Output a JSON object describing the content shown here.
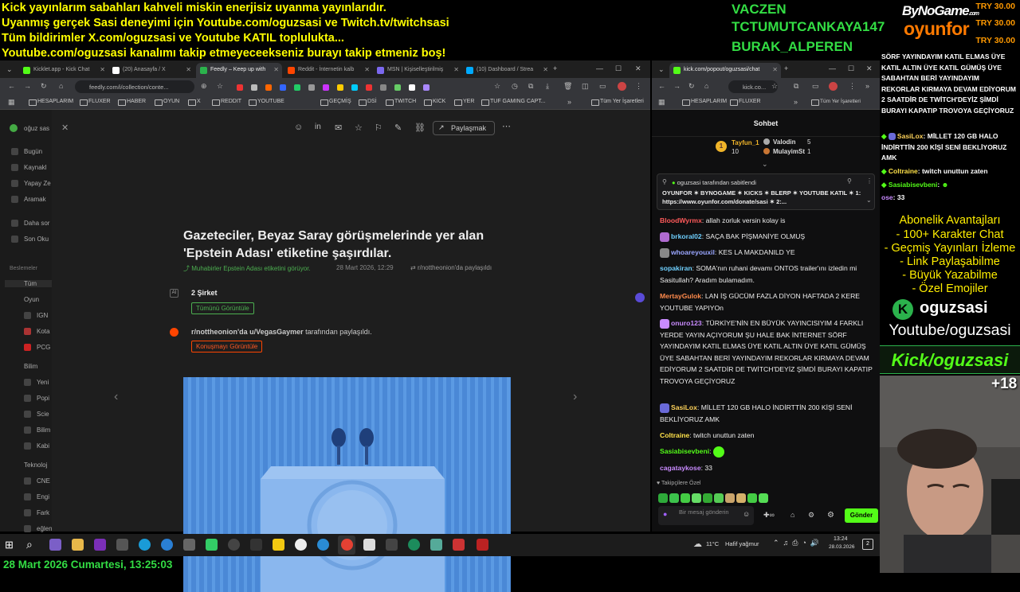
{
  "overlay": {
    "lines": [
      "Kick yayınlarım sabahları kahveli miskin enerjisiz uyanma yayınlarıdır.",
      "Uyanmış gerçek Sasi deneyimi için Youtube.com/oguzsasi ve Twitch.tv/twitchsasi",
      "Tüm bildirimler X.com/oguzsasi ve Youtube KATIL toplulukta...",
      "Youtube.com/oguzsasi kanalımı takip etmeyeceekseniz burayı takip etmeniz boş!"
    ],
    "vips": [
      "VACZEN",
      "TCTUMUTCANKAYA147",
      "BURAK_ALPEREN"
    ],
    "sponsor_top": "ByNoGame",
    "sponsor_top_small": ".com",
    "sponsor_main": "oyunfor",
    "donations": [
      "TRY 30.00",
      "TRY 30.00",
      "TRY 30.00"
    ],
    "datetime": "28 Mart 2026 Cumartesi, 13:25:03",
    "accent_yellow": "#ffff00",
    "accent_green": "#33dd44"
  },
  "left_browser": {
    "tabs": [
      {
        "label": "Kicklet.app - Kick Chat",
        "color": "#53fc18"
      },
      {
        "label": "(20) Anasayfa / X",
        "color": "#ffffff"
      },
      {
        "label": "Feedly – Keep up with",
        "color": "#2bb24c"
      },
      {
        "label": "Reddit - İnternetin kalb",
        "color": "#ff4500"
      },
      {
        "label": "MSN | Kişiselleştirilmiş",
        "color": "#7b68ee"
      },
      {
        "label": "(10) Dashboard / Strea",
        "color": "#00aaff"
      }
    ],
    "url": "feedly.com/i/collection/conte...",
    "bookmarks": [
      "HESAPLARIM",
      "FLUXER",
      "HABER",
      "OYUN",
      "X",
      "REDDIT",
      "YOUTUBE",
      "GEÇMİŞ",
      "DSİ",
      "TWITCH",
      "KICK",
      "YER",
      "TUF GAMING CAPT...",
      "Tüm Yer İşaretleri"
    ]
  },
  "feedly": {
    "user": "oğuz sas",
    "sidebar_top": [
      "Bugün",
      "Kaynakl",
      "Yapay Ze",
      "Aramak",
      "Daha sor",
      "Son Oku"
    ],
    "section_label": "Beslemeler",
    "all": "Tüm",
    "groups": [
      {
        "name": "Oyun",
        "items": [
          "IGN",
          "Kota",
          "PCG"
        ]
      },
      {
        "name": "Bilim",
        "items": [
          "Yeni",
          "Popi",
          "Scie",
          "Bilim",
          "Kabi"
        ]
      },
      {
        "name": "Teknoloj",
        "items": [
          "CNE",
          "Engi",
          "Fark",
          "eğlen"
        ]
      }
    ],
    "share_label": "Paylaşmak",
    "article_title": "Gazeteciler, Beyaz Saray görüşmelerinde yer alan 'Epstein Adası' etiketine şaşırdılar.",
    "article_source": "Muhabirler Epstein Adası etiketini görüyor.",
    "article_date": "28 Mart 2026, 12:29",
    "article_shared": "r/nottheonion'da paylaşıldı",
    "companies": "2 Şirket",
    "view_all": "Tümünü Görüntüle",
    "reddit_line_bold": "r/nottheonion'da u/VegasGaymer",
    "reddit_line_rest": " tarafından paylaşıldı.",
    "view_conv": "Konuşmayı Görüntüle"
  },
  "chat_browser": {
    "tab_label": "kick.com/popout/oguzsasi/chat",
    "url": "kick.co...",
    "bookmarks": [
      "HESAPLARIM",
      "FLUXER",
      "Tüm Yer İşaretleri"
    ],
    "header": "Sohbet",
    "leaders": [
      {
        "name": "Tayfun_1",
        "count": "10"
      },
      {
        "name": "Valodin",
        "count": "5"
      },
      {
        "name": "MulayimSt",
        "count": "1"
      }
    ],
    "pinned_by": "oguzsasi tarafından sabitlendi",
    "pinned_text": "OYUNFOR ✶ BYNOGAME ✶ KICKS ✶ BLERP ✶ YOUTUBE KATIL ✶ 1: https://www.oyunfor.com/donate/sasi ✶ 2:...",
    "messages": [
      {
        "user": "BloodWyrmx",
        "color": "#ff5a5a",
        "text": "allah zorluk versin kolay is"
      },
      {
        "user": "brkoral02",
        "color": "#6fd0ff",
        "text": "SAÇA BAK PİŞMANİYE OLMUŞ"
      },
      {
        "user": "whoareyouxil",
        "color": "#9aa6ff",
        "text": "KES LA MAKDANILD YE"
      },
      {
        "user": "sopakiran",
        "color": "#6fd0ff",
        "text": "SOMA'nın ruhani devamı ONTOS trailer'ını izledin mi Sasitullah? Aradım bulamadım."
      },
      {
        "user": "MertayGulok",
        "color": "#ff8a4c",
        "text": "LAN İŞ GÜCÜM FAZLA DİYON HAFTADA 2 KERE YOUTUBE YAPIYOn"
      },
      {
        "user": "onuro123",
        "color": "#c98bff",
        "text": "TÜRKİYE'NİN EN BÜYÜK YAYINCISIYIM 4 FARKLI YERDE YAYIN AÇIYORUM ŞU HALE BAK İNTERNET SÖRF YAYINDAYIM KATIL ELMAS ÜYE KATIL ALTIN ÜYE KATIL GÜMÜŞ ÜYE SABAHTAN BERİ YAYINDAYIM REKORLAR KIRMAYA DEVAM EDİYORUM 2 SAATDİR DE TWİTCH'DEYİZ ŞİMDİ BURAYI KAPATIP TROVOYA GEÇİYORUZ"
      },
      {
        "user": "SasiLox",
        "color": "#ffd35a",
        "text": "MİLLET 120 GB HALO İNDİRTTİN 200 KİŞİ SENİ BEKLİYORUZ AMK"
      },
      {
        "user": "Coltraine",
        "color": "#ffe24a",
        "text": "twitch unuttun zaten"
      },
      {
        "user": "Sasiabisevbeni",
        "color": "#53fc18",
        "text": ""
      },
      {
        "user": "cagataykose",
        "color": "#c98bff",
        "text": "33"
      }
    ],
    "emote_label": "Takipçilere Özel",
    "input_placeholder": "Bir mesaj gönderin",
    "send_label": "Gönder"
  },
  "right_overlay": {
    "chat_overflow": "SÖRF YAYINDAYIM KATIL ELMAS ÜYE KATIL ALTIN ÜYE KATIL GÜMÜŞ ÜYE SABAHTAN BERİ YAYINDAYIM REKORLAR KIRMAYA DEVAM EDİYORUM 2 SAATDİR DE TWİTCH'DEYİZ ŞİMDİ BURAYI KAPATIP TROVOYA GEÇİYORUZ",
    "chat_lines": [
      {
        "user": "SasiLox",
        "text": "MİLLET 120 GB HALO İNDİRTTİN 200 KİŞİ SENİ BEKLİYORUZ AMK"
      },
      {
        "user": "Coltraine",
        "text": "twitch unuttun zaten"
      },
      {
        "user": "Sasiabisevbeni",
        "text": ""
      },
      {
        "user": "ose",
        "text": "33"
      }
    ],
    "perks_title": "Abonelik Avantajları",
    "perks": [
      "- 100+ Karakter Chat",
      "- Geçmiş Yayınları İzleme",
      "- Link Paylaşabilme",
      "- Büyük Yazabilme",
      "- Özel Emojiler"
    ],
    "kick_name": "oguzsasi",
    "youtube": "Youtube/oguzsasi",
    "kick_banner": "Kick/oguzsasi",
    "age": "+18"
  },
  "taskbar": {
    "weather": "11°C",
    "weather_text": "Hafif yağmur",
    "time": "13:24",
    "date": "28.03.2026",
    "notif": "2"
  }
}
